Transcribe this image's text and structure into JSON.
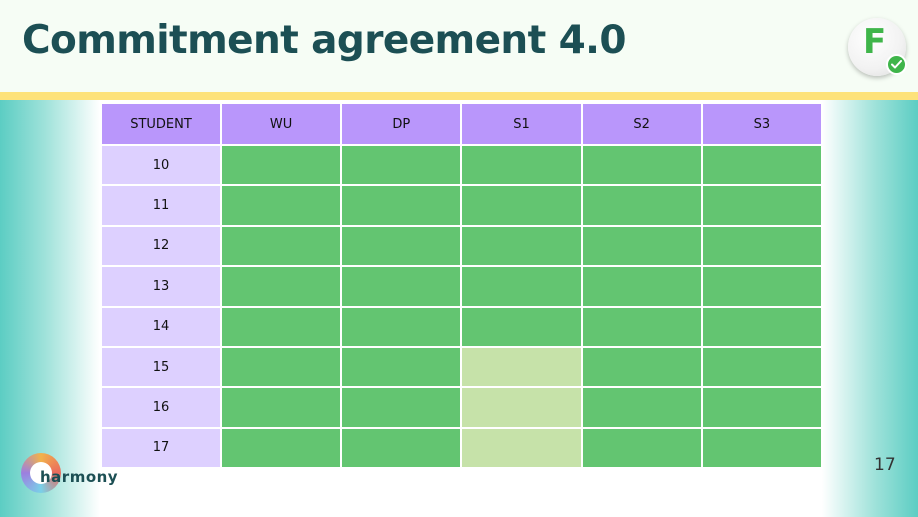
{
  "slide": {
    "title": "Commitment agreement 4.0",
    "page_number": "17"
  },
  "brand": {
    "logo_letter": "F",
    "logo_icon": "check-circle-icon",
    "footer_logo_text": "harmony",
    "colors": {
      "title": "#1c4f54",
      "accent_bar": "#fde27a",
      "header_cell": "#b996fb",
      "student_cell": "#ddd0ff",
      "status_complete": "#63c571",
      "status_partial": "#c6e2a9"
    }
  },
  "table": {
    "columns": [
      "STUDENT",
      "WU",
      "DP",
      "S1",
      "S2",
      "S3"
    ],
    "rows": [
      {
        "student": "10",
        "statuses": [
          "green",
          "green",
          "green",
          "green",
          "green"
        ]
      },
      {
        "student": "11",
        "statuses": [
          "green",
          "green",
          "green",
          "green",
          "green"
        ]
      },
      {
        "student": "12",
        "statuses": [
          "green",
          "green",
          "green",
          "green",
          "green"
        ]
      },
      {
        "student": "13",
        "statuses": [
          "green",
          "green",
          "green",
          "green",
          "green"
        ]
      },
      {
        "student": "14",
        "statuses": [
          "green",
          "green",
          "green",
          "green",
          "green"
        ]
      },
      {
        "student": "15",
        "statuses": [
          "green",
          "green",
          "light",
          "green",
          "green"
        ]
      },
      {
        "student": "16",
        "statuses": [
          "green",
          "green",
          "light",
          "green",
          "green"
        ]
      },
      {
        "student": "17",
        "statuses": [
          "green",
          "green",
          "light",
          "green",
          "green"
        ]
      }
    ]
  }
}
